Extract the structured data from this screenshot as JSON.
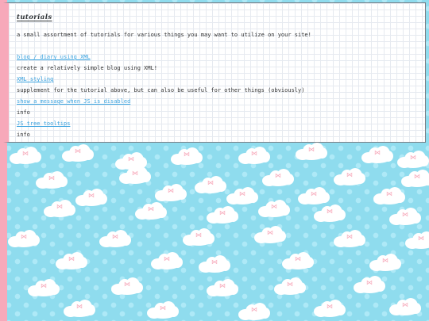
{
  "page": {
    "title": "tutorials",
    "intro": "a small assortment of tutorials for various things you may want to utilize on your site!",
    "entries": [
      {
        "link": "blog / diary using XML",
        "description": "create a relatively simple blog using XML!"
      },
      {
        "link": "XML styling",
        "description": "supplement for the tutorial above, but can also be useful for other things (obviously)"
      },
      {
        "link": "show a message when JS is disabled",
        "description": "info"
      },
      {
        "link": "JS tree tooltips",
        "description": "info"
      }
    ]
  },
  "colors": {
    "background": "#8fdcee",
    "accent_pink": "#f7a9ba",
    "link": "#3ba3df"
  },
  "background_pattern": "cloud-with-bow-icon"
}
